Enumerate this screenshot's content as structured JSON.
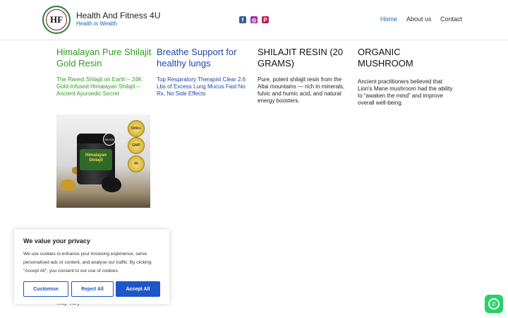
{
  "header": {
    "logo_text": "HF",
    "site_title": "Health And Fitness 4U",
    "tagline": "Health is Wealth",
    "social": {
      "facebook": "f",
      "instagram": "◎",
      "pinterest": "P"
    },
    "nav": [
      "Home",
      "About us",
      "Contact"
    ]
  },
  "cards": [
    {
      "title": "Himalayan Pure Shilajit Gold Resin",
      "text": "The Rarest Shilajit on Earth – 24K Gold-Infused Himalayan Shilajit – Ancient Ayurvedic Secret",
      "color": "#2e9c1e"
    },
    {
      "title": "Breathe Support for healthy lungs",
      "text": "Top Respiratory Therapist Clear 2.6 Lbs of Excess Lung Mucus Fast No Rx, No Side Effects",
      "color": "#1e47a8"
    },
    {
      "title": "SHILAJIT RESIN (20 GRAMS)",
      "text": "Pure, potent shilajit resin from the Altai mountains — rich in minerals, fulvic and humic acid, and natural energy boosters."
    },
    {
      "title": "ORGANIC MUSHROOM",
      "text": "Ancient practitioners believed that Lion's Mane mushroom had the ability to “awaken the mind” and improve overall well-being."
    }
  ],
  "product_image": {
    "jar_label": "Himalayan Shilajit",
    "seals": [
      "500k+",
      "GMP",
      "90"
    ],
    "sticker": "TIKTOK"
  },
  "partial_text": "May Vary",
  "cookie": {
    "title": "We value your privacy",
    "text": "We use cookies to enhance your browsing experience, serve personalised ads or content, and analyse our traffic. By clicking \"Accept All\", you consent to our use of cookies.",
    "buttons": {
      "customise": "Customise",
      "reject": "Reject All",
      "accept": "Accept All"
    }
  },
  "whatsapp_icon": "whatsapp-icon",
  "colors": {
    "brand_blue": "#1565c0",
    "button_blue": "#1e56c8",
    "green": "#2e9c1e",
    "whatsapp": "#25d366"
  }
}
